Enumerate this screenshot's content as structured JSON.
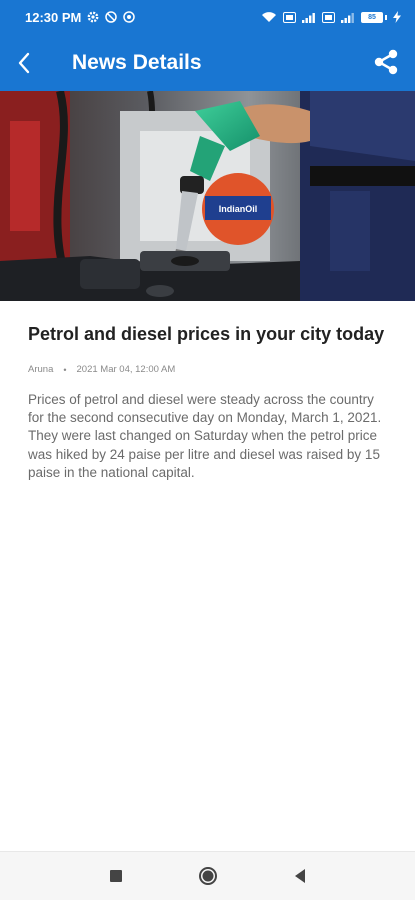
{
  "status_bar": {
    "time": "12:30 PM",
    "left_icons": [
      "gear-icon",
      "no-disturb-icon",
      "data-saver-icon"
    ],
    "right_icons": [
      "wifi-icon",
      "volte-icon",
      "signal-icon",
      "volte2-icon",
      "signal2-icon"
    ],
    "battery_label": "85",
    "battery_charging": true
  },
  "app_bar": {
    "title": "News Details",
    "back_icon": "chevron-left-icon",
    "share_icon": "share-icon",
    "color": "#1976d2"
  },
  "article": {
    "headline": "Petrol and diesel prices in your city today",
    "author": "Aruna",
    "separator": "•",
    "timestamp": "2021 Mar 04, 12:00 AM",
    "body": "Prices of petrol and diesel were steady across the country for the second consecutive day on Monday, March 1, 2021. They were last changed on Saturday when the petrol price was hiked by 24 paise per litre and diesel was raised by 15 paise in the national capital."
  },
  "nav_bar": {
    "buttons": [
      "recents-square-icon",
      "home-circle-icon",
      "back-triangle-icon"
    ]
  }
}
